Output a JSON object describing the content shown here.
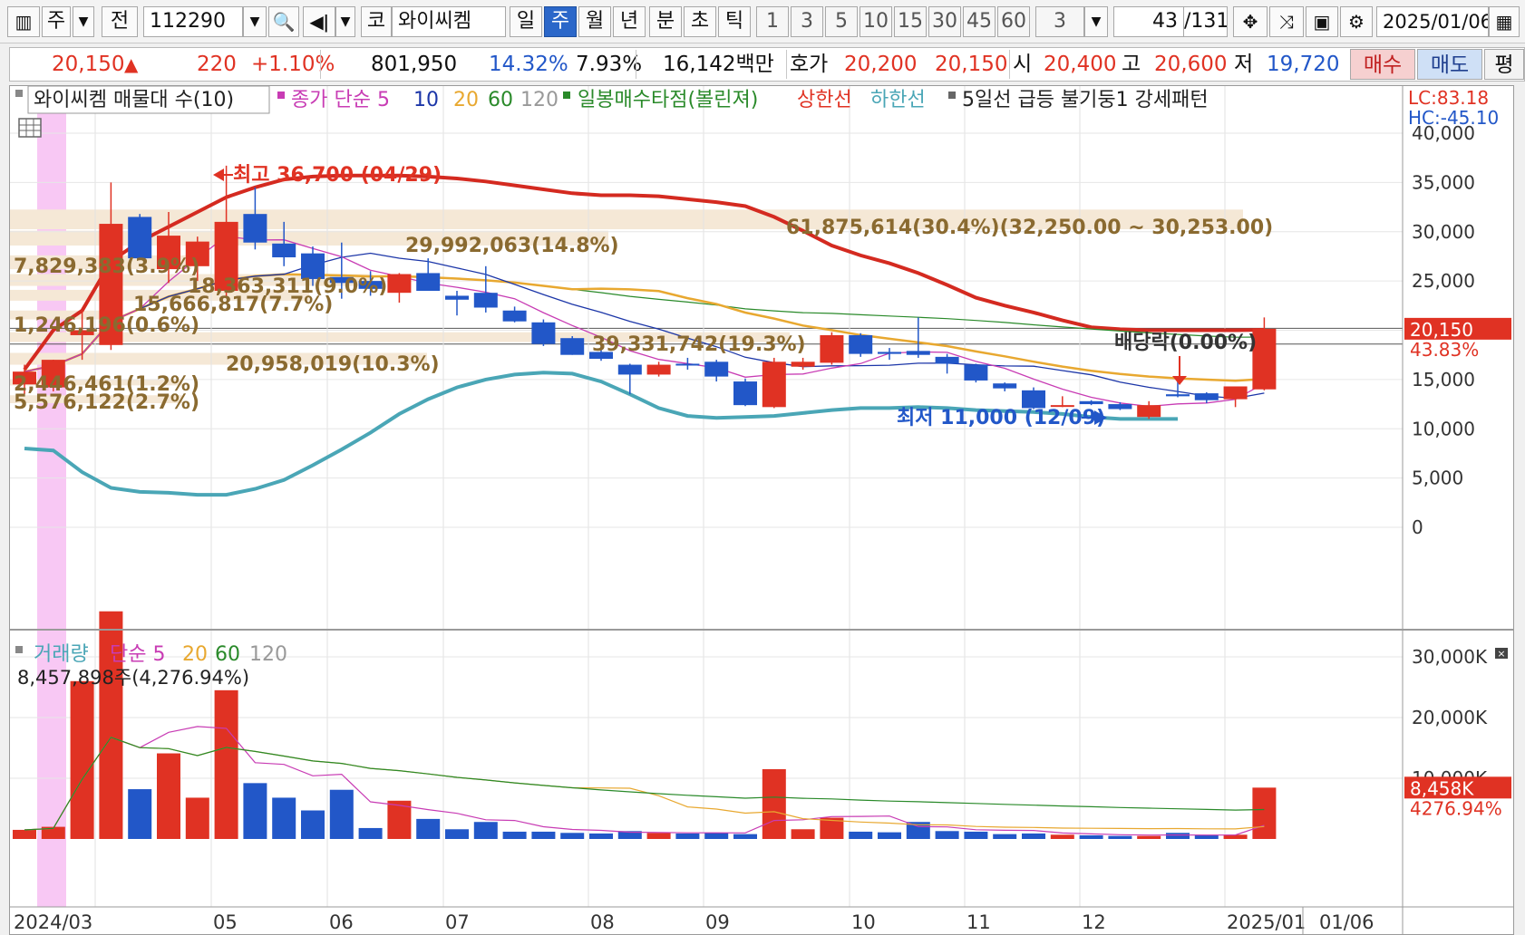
{
  "toolbar": {
    "type_label": "주",
    "prefix_label": "전",
    "code_value": "112290",
    "market_label": "코",
    "stock_name": "와이씨켐",
    "period_tabs": [
      "일",
      "주",
      "월",
      "년",
      "분",
      "초",
      "틱"
    ],
    "active_tab": "주",
    "interval_numbers": [
      "1",
      "3",
      "5",
      "10",
      "15",
      "30",
      "45",
      "60"
    ],
    "multiplier_value": "3",
    "page_current": "43",
    "page_total": "/131",
    "date_value": "2025/01/06"
  },
  "quote": {
    "price": "20,150",
    "change": "220",
    "change_pct": "+1.10%",
    "volume": "801,950",
    "turnover_pct": "14.32%",
    "ratio_pct": "7.93%",
    "amount": "16,142백만",
    "bid_label": "호가",
    "ask_price": "20,200",
    "bid_price": "20,150",
    "open_label": "시",
    "open": "20,400",
    "high_label": "고",
    "high": "20,600",
    "low_label": "저",
    "low": "19,720",
    "buy_label": "매수",
    "sell_label": "매도",
    "eval_label": "평"
  },
  "colors": {
    "up": "#e03223",
    "down": "#2257c8",
    "ma5": "#c83cb4",
    "ma10": "#1c36a8",
    "ma20": "#e8a830",
    "ma60": "#2a8a2a",
    "upper_band": "#d42a20",
    "lower_band": "#4aa6b6",
    "volume_profile": "#f5e8d6",
    "highlight": "#f8c8f4"
  },
  "price_panel": {
    "legend": {
      "title": "와이씨켐 매물대 수(10)",
      "ma_title": "종가 단순 5",
      "ma_periods": [
        "10",
        "20",
        "60",
        "120"
      ],
      "signal_title": "일봉매수타점(볼린져)",
      "upper_label": "상한선",
      "lower_label": "하한선",
      "pattern_label": "5일선 급등 불기둥1 강세패턴"
    },
    "lc_label": "LC:83.18",
    "hc_label": "HC:-45.10",
    "y_ticks": [
      "40,000",
      "35,000",
      "30,000",
      "25,000",
      "20,000",
      "15,000",
      "10,000",
      "5,000",
      "0"
    ],
    "last_price_label": "20,150",
    "last_pct_label": "43.83%",
    "high_annotation": "최고 36,700 (04/29)",
    "low_annotation": "최저 11,000 (12/09)",
    "dividend_annotation": "배당락(0.00%)",
    "volume_profile_labels": [
      "61,875,614(30.4%)(32,250.00 ~ 30,253.00)",
      "29,992,063(14.8%)",
      "7,829,383(3.9%)",
      "18,363,311(9.0%)",
      "15,666,817(7.7%)",
      "1,246,196(0.6%)",
      "39,331,742(19.3%)",
      "20,958,019(10.3%)",
      "2,446,461(1.2%)",
      "5,576,122(2.7%)"
    ]
  },
  "volume_panel": {
    "legend": {
      "title": "거래량",
      "ma_title": "단순 5",
      "ma_periods": [
        "20",
        "60",
        "120"
      ]
    },
    "info_label": "8,457,898주(4,276.94%)",
    "y_ticks": [
      "30,000K",
      "20,000K",
      "10,000K"
    ],
    "last_volume_label": "8,458K",
    "last_pct_label": "4276.94%"
  },
  "x_axis": {
    "labels": [
      "2024/03",
      "05",
      "06",
      "07",
      "08",
      "09",
      "10",
      "11",
      "12",
      "2025/01"
    ],
    "cursor_label": "01/06"
  },
  "chart_data": {
    "type": "candlestick",
    "title": "와이씨켐 매물대 수(10)",
    "ylim": [
      0,
      40000
    ],
    "candles": [
      {
        "o": 14500,
        "h": 16500,
        "l": 13500,
        "c": 15800
      },
      {
        "o": 14200,
        "h": 17000,
        "l": 13800,
        "c": 17000
      },
      {
        "o": 19500,
        "h": 22000,
        "l": 17000,
        "c": 20000
      },
      {
        "o": 18500,
        "h": 35000,
        "l": 18000,
        "c": 30800
      },
      {
        "o": 31500,
        "h": 31800,
        "l": 27200,
        "c": 27300
      },
      {
        "o": 26200,
        "h": 32000,
        "l": 24800,
        "c": 29600
      },
      {
        "o": 26500,
        "h": 29500,
        "l": 25000,
        "c": 29000
      },
      {
        "o": 24000,
        "h": 36700,
        "l": 23500,
        "c": 31000
      },
      {
        "o": 31800,
        "h": 34500,
        "l": 28200,
        "c": 28900
      },
      {
        "o": 28800,
        "h": 31000,
        "l": 26500,
        "c": 27400
      },
      {
        "o": 27800,
        "h": 28500,
        "l": 24500,
        "c": 25200
      },
      {
        "o": 25400,
        "h": 28900,
        "l": 23200,
        "c": 24800
      },
      {
        "o": 25000,
        "h": 26000,
        "l": 23500,
        "c": 24200
      },
      {
        "o": 23800,
        "h": 25800,
        "l": 22800,
        "c": 25700
      },
      {
        "o": 25800,
        "h": 27300,
        "l": 24000,
        "c": 24000
      },
      {
        "o": 23500,
        "h": 24000,
        "l": 21500,
        "c": 23100
      },
      {
        "o": 23800,
        "h": 26500,
        "l": 21800,
        "c": 22300
      },
      {
        "o": 22000,
        "h": 22400,
        "l": 20800,
        "c": 20900
      },
      {
        "o": 20800,
        "h": 21100,
        "l": 18400,
        "c": 18600
      },
      {
        "o": 19200,
        "h": 19400,
        "l": 17500,
        "c": 17500
      },
      {
        "o": 17800,
        "h": 18500,
        "l": 16900,
        "c": 17100
      },
      {
        "o": 16500,
        "h": 16600,
        "l": 13500,
        "c": 15500
      },
      {
        "o": 15500,
        "h": 16800,
        "l": 15300,
        "c": 16500
      },
      {
        "o": 16600,
        "h": 17200,
        "l": 16000,
        "c": 16500
      },
      {
        "o": 16800,
        "h": 17000,
        "l": 14800,
        "c": 15300
      },
      {
        "o": 14800,
        "h": 15100,
        "l": 12300,
        "c": 12400
      },
      {
        "o": 12200,
        "h": 17200,
        "l": 12100,
        "c": 16800
      },
      {
        "o": 16300,
        "h": 17200,
        "l": 16000,
        "c": 16800
      },
      {
        "o": 16700,
        "h": 19800,
        "l": 16500,
        "c": 19500
      },
      {
        "o": 19500,
        "h": 19700,
        "l": 17300,
        "c": 17600
      },
      {
        "o": 17800,
        "h": 18200,
        "l": 17000,
        "c": 17600
      },
      {
        "o": 17900,
        "h": 21300,
        "l": 17200,
        "c": 17500
      },
      {
        "o": 17300,
        "h": 17600,
        "l": 15600,
        "c": 16600
      },
      {
        "o": 16500,
        "h": 16600,
        "l": 14700,
        "c": 14900
      },
      {
        "o": 14600,
        "h": 14700,
        "l": 13800,
        "c": 14100
      },
      {
        "o": 13900,
        "h": 14200,
        "l": 12000,
        "c": 12100
      },
      {
        "o": 12300,
        "h": 13300,
        "l": 12200,
        "c": 12400
      },
      {
        "o": 12800,
        "h": 12900,
        "l": 12400,
        "c": 12500
      },
      {
        "o": 12500,
        "h": 12700,
        "l": 11900,
        "c": 12000
      },
      {
        "o": 11200,
        "h": 12800,
        "l": 11000,
        "c": 12400
      },
      {
        "o": 13500,
        "h": 14800,
        "l": 13200,
        "c": 13300
      },
      {
        "o": 13600,
        "h": 13700,
        "l": 12600,
        "c": 12900
      },
      {
        "o": 13000,
        "h": 14300,
        "l": 12200,
        "c": 14300
      },
      {
        "o": 14000,
        "h": 21300,
        "l": 13900,
        "c": 20150
      }
    ],
    "volumes": [
      1500,
      2000,
      26000,
      37500,
      8200,
      14100,
      6800,
      24500,
      9200,
      6800,
      4700,
      8100,
      1800,
      6300,
      3300,
      1600,
      2800,
      1200,
      1200,
      1000,
      900,
      1300,
      1000,
      900,
      1000,
      800,
      11500,
      1600,
      3500,
      1200,
      1100,
      2800,
      1300,
      1200,
      800,
      900,
      700,
      600,
      500,
      500,
      1000,
      600,
      700,
      8458
    ],
    "upper_band": [
      16000,
      20000,
      22000,
      27000,
      29000,
      30500,
      32000,
      33500,
      34500,
      35300,
      35600,
      35700,
      35700,
      35700,
      35600,
      35400,
      35100,
      34700,
      34300,
      33900,
      33700,
      33700,
      33600,
      33300,
      33000,
      32600,
      31500,
      30100,
      28600,
      27600,
      26800,
      25800,
      24600,
      23300,
      22500,
      21800,
      21000,
      20300,
      20100,
      20000,
      20000,
      20000,
      20000,
      20050
    ],
    "lower_band": [
      8000,
      7800,
      5600,
      4000,
      3600,
      3500,
      3300,
      3300,
      3900,
      4800,
      6300,
      7900,
      9600,
      11500,
      13000,
      14200,
      15000,
      15500,
      15700,
      15600,
      14800,
      13500,
      12100,
      11300,
      11100,
      11200,
      11300,
      11600,
      11900,
      12100,
      12100,
      12200,
      12100,
      11900,
      11800,
      11700,
      11500,
      11200,
      11000,
      11000,
      11000
    ]
  }
}
